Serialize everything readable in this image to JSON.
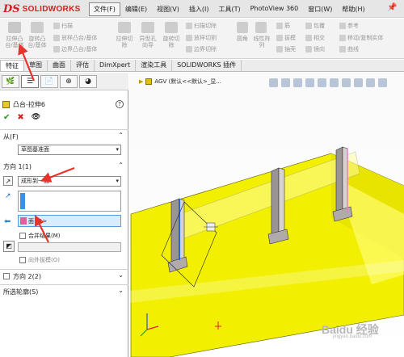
{
  "app": {
    "logo_ds": "DS",
    "logo_text": "SOLIDWORKS"
  },
  "menu": [
    "文件(F)",
    "编辑(E)",
    "视图(V)",
    "插入(I)",
    "工具(T)",
    "PhotoView 360",
    "窗口(W)",
    "帮助(H)"
  ],
  "ribbon": {
    "extrude_boss": "拉伸凸\n台/基体",
    "revolve_boss": "旋转凸\n台/基体",
    "sweep": "扫描",
    "loft_boss": "放样凸台/基体",
    "boundary_boss": "边界凸台/基体",
    "extrude_cut": "拉伸切\n除",
    "hole_wizard": "异型孔\n向导",
    "revolve_cut": "旋转切\n除",
    "sweep_cut": "扫描切除",
    "loft_cut": "放样切割",
    "boundary_cut": "边界切除",
    "fillet": "圆角",
    "linear_pattern": "线性阵\n列",
    "rib": "筋",
    "draft": "拔模",
    "shell": "抽壳",
    "wrap": "包覆",
    "intersect": "相交",
    "mirror": "镜向",
    "ref_geom": "参考",
    "move_copy": "移动/复制实体",
    "curves": "曲线"
  },
  "tabs": [
    "特征",
    "草图",
    "曲面",
    "评估",
    "DimXpert",
    "渲染工具",
    "SOLIDWORKS 插件"
  ],
  "panel": {
    "feature_title": "凸台-拉伸6",
    "help": "?",
    "from_label": "从(F)",
    "from_value": "草图基准面",
    "direction1_label": "方向 1(1)",
    "end_condition": "成形到一面",
    "face_value": "面<1>",
    "merge_label": "合并结果(M)",
    "draft_outward": "向外拔模(O)",
    "direction2_label": "方向 2(2)",
    "selected_contours": "所选轮廓(S)"
  },
  "viewport": {
    "tree_item": "AGV  (默认<<默认>_显..."
  },
  "watermark": {
    "main": "Baidu 经验",
    "sub": "jingyan.baidu.com"
  },
  "colors": {
    "part_yellow": "#f2f000",
    "plate_color": "#c9c1c1",
    "arrow_red": "#e8322a",
    "brand_red": "#d21f1f"
  }
}
